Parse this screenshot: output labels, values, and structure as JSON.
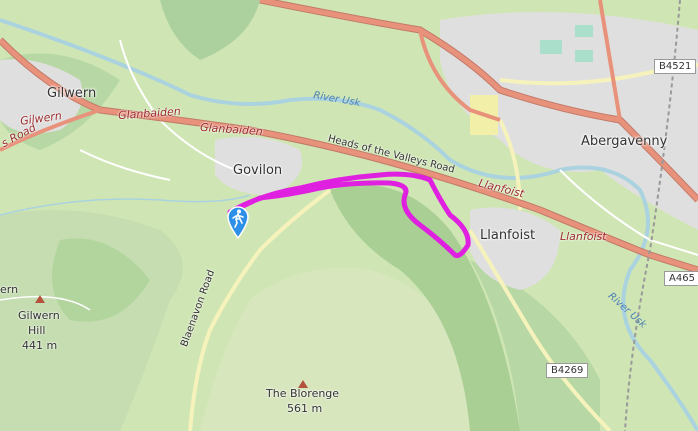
{
  "towns": {
    "gilwern": "Gilwern",
    "govilon": "Govilon",
    "abergavenny": "Abergavenny",
    "llanfoist": "Llanfoist"
  },
  "roads": {
    "glanbaiden_1": "Glanbaiden",
    "glanbaiden_2": "Glanbaiden",
    "gilwern_red": "Gilwern",
    "road_left": "s Road",
    "heads_of_valleys": "Heads of the Valleys Road",
    "llanfoist_red_1": "Llanfoist",
    "llanfoist_red_2": "Llanfoist",
    "blaenavon_road": "Blaenavon Road"
  },
  "shields": {
    "b4521": "B4521",
    "a465": "A465",
    "b4269": "B4269"
  },
  "rivers": {
    "usk_1": "River Usk",
    "usk_2": "River Usk"
  },
  "peaks": {
    "gilwern_hill_name_a": "ern",
    "gilwern_hill_name_b": "Gilwern",
    "gilwern_hill_name_c": "Hill",
    "gilwern_hill_elev": "441 m",
    "blorenge_name": "The Blorenge",
    "blorenge_elev": "561 m"
  },
  "route": {
    "color": "#e020e0"
  },
  "colors": {
    "main_road": "#e8927c",
    "minor_road": "#f6f2bc",
    "river": "#aad3df",
    "urban": "#e0dfdf",
    "forest": "#add19e",
    "grass": "#cfe6b4"
  }
}
